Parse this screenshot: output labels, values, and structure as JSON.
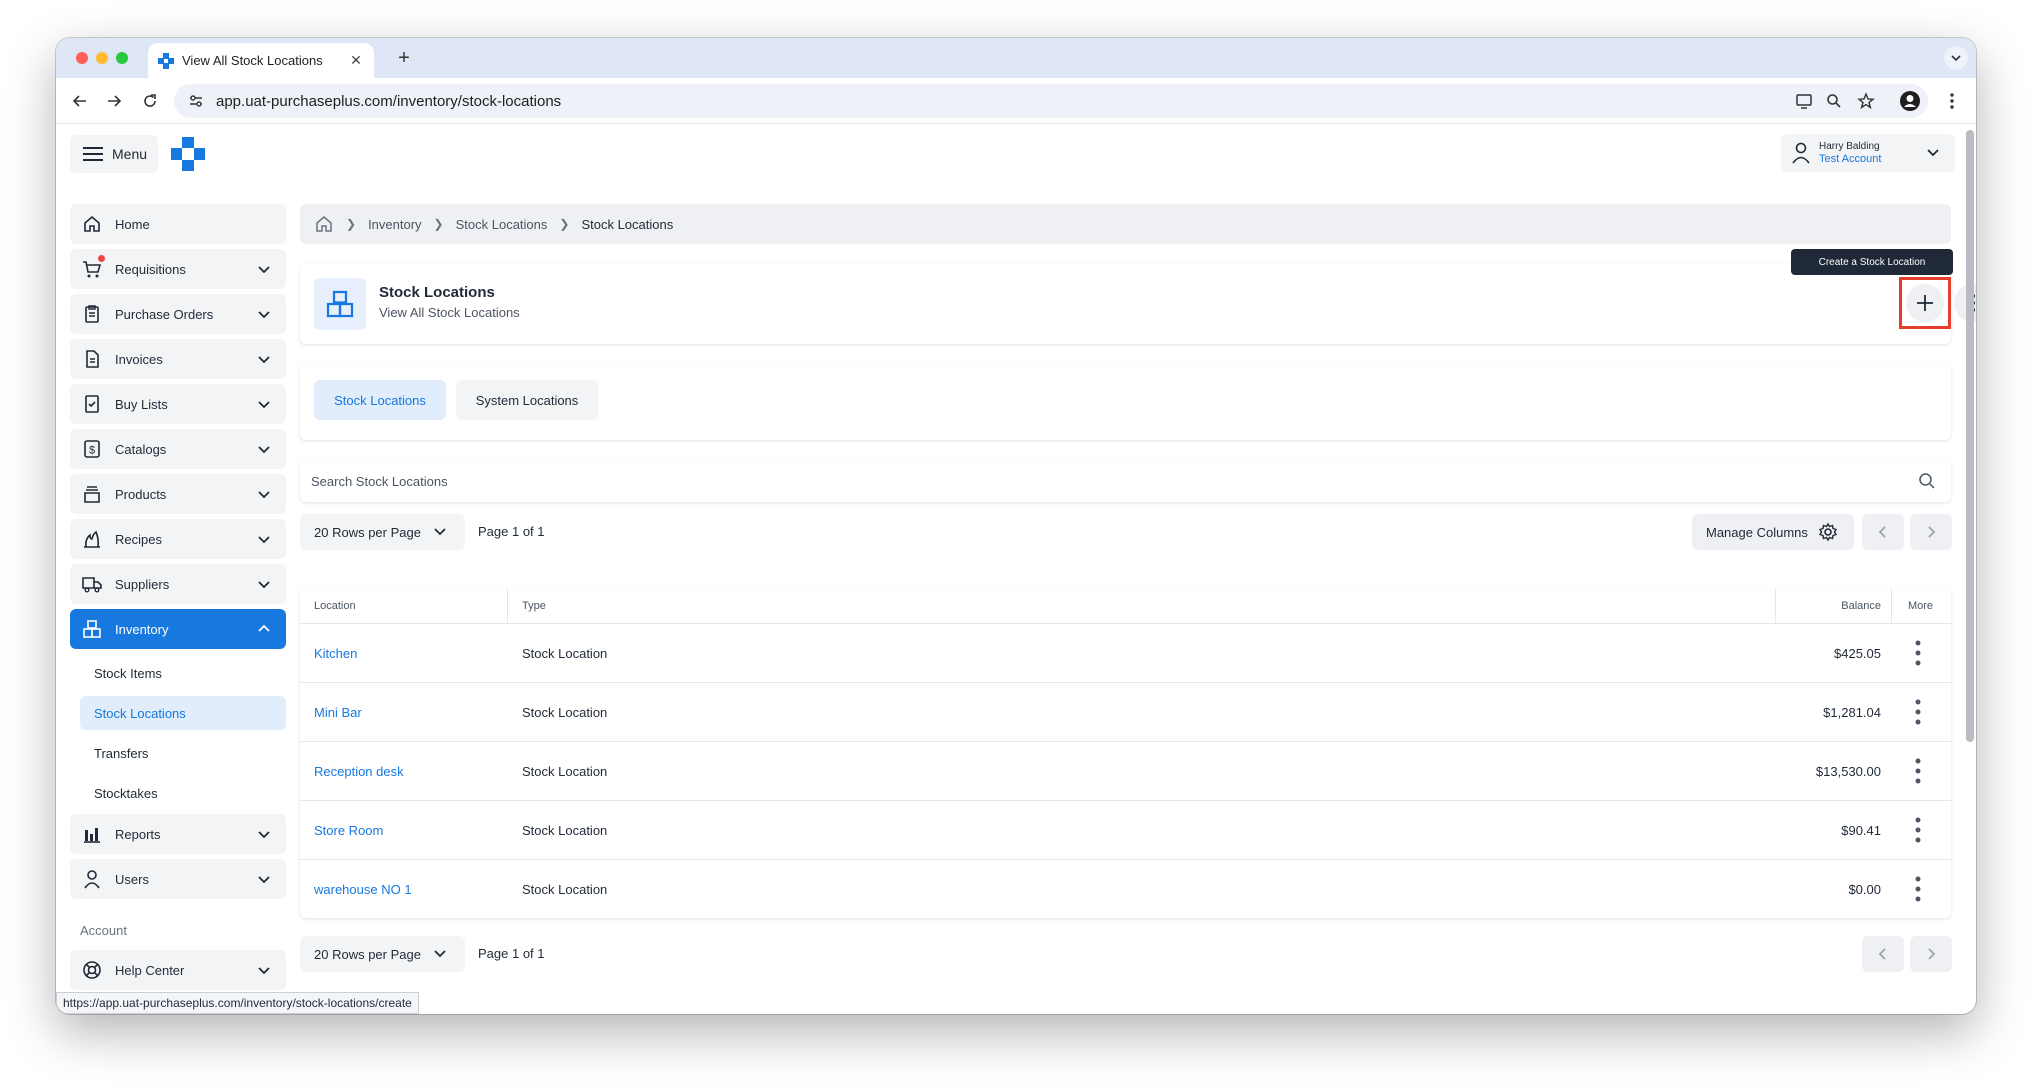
{
  "browser": {
    "tab_title": "View All Stock Locations",
    "tab_close": "✕",
    "new_tab": "+",
    "url": "app.uat-purchaseplus.com/inventory/stock-locations",
    "status_url": "https://app.uat-purchaseplus.com/inventory/stock-locations/create"
  },
  "header": {
    "menu_label": "Menu",
    "user_name": "Harry Balding",
    "user_account": "Test Account"
  },
  "sidebar": {
    "items": [
      {
        "label": "Home",
        "icon": "home-icon"
      },
      {
        "label": "Requisitions",
        "icon": "cart-icon"
      },
      {
        "label": "Purchase Orders",
        "icon": "clipboard-icon"
      },
      {
        "label": "Invoices",
        "icon": "document-icon"
      },
      {
        "label": "Buy Lists",
        "icon": "checklist-icon"
      },
      {
        "label": "Catalogs",
        "icon": "dollar-icon"
      },
      {
        "label": "Products",
        "icon": "box-icon"
      },
      {
        "label": "Recipes",
        "icon": "flame-icon"
      },
      {
        "label": "Suppliers",
        "icon": "truck-icon"
      },
      {
        "label": "Inventory",
        "icon": "boxes-icon"
      }
    ],
    "inventory_sub": [
      "Stock Items",
      "Stock Locations",
      "Transfers",
      "Stocktakes"
    ],
    "after_items": [
      {
        "label": "Reports",
        "icon": "chart-icon"
      },
      {
        "label": "Users",
        "icon": "user-icon"
      }
    ],
    "account_label": "Account",
    "help_center": "Help Center"
  },
  "breadcrumb": {
    "items": [
      "Inventory",
      "Stock Locations",
      "Stock Locations"
    ]
  },
  "page": {
    "title": "Stock Locations",
    "subtitle": "View All Stock Locations",
    "tooltip": "Create a Stock Location"
  },
  "tabs": [
    "Stock Locations",
    "System Locations"
  ],
  "search": {
    "placeholder": "Search Stock Locations"
  },
  "pagination": {
    "rows_per_page": "20 Rows per Page",
    "page_info": "Page 1 of 1",
    "manage_columns": "Manage Columns"
  },
  "table": {
    "headers": [
      "Location",
      "Type",
      "Balance",
      "More"
    ],
    "rows": [
      {
        "location": "Kitchen",
        "type": "Stock Location",
        "balance": "$425.05"
      },
      {
        "location": "Mini Bar",
        "type": "Stock Location",
        "balance": "$1,281.04"
      },
      {
        "location": "Reception desk",
        "type": "Stock Location",
        "balance": "$13,530.00"
      },
      {
        "location": "Store Room",
        "type": "Stock Location",
        "balance": "$90.41"
      },
      {
        "location": "warehouse NO 1",
        "type": "Stock Location",
        "balance": "$0.00"
      }
    ]
  },
  "colors": {
    "accent": "#1778e0",
    "highlight": "#e53e2e"
  }
}
